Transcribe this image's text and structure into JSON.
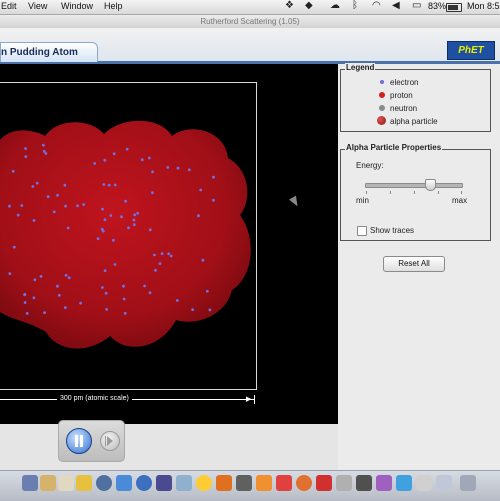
{
  "menubar": {
    "items": [
      "Edit",
      "View",
      "Window",
      "Help"
    ],
    "battery": "83%",
    "clock": "Mon 8:5",
    "icons": [
      "dropbox-icon",
      "evernote-icon",
      "bluetooth-icon",
      "wifi-icon",
      "volume-icon",
      "battery-icon"
    ]
  },
  "window": {
    "title": "Rutherford Scattering (1.05)"
  },
  "tab": {
    "label": "n Pudding Atom"
  },
  "logo": {
    "text": "PhET"
  },
  "scale_label": "300 pm (atomic scale)",
  "legend": {
    "title": "Legend",
    "items": [
      {
        "label": "electron",
        "color": "#6f6fd8"
      },
      {
        "label": "proton",
        "color": "#d02020"
      },
      {
        "label": "neutron",
        "color": "#8a8a8a"
      },
      {
        "label": "alpha particle",
        "color": "#c03030"
      }
    ]
  },
  "alpha_props": {
    "title": "Alpha Particle Properties",
    "energy_label": "Energy:",
    "min_label": "min",
    "max_label": "max",
    "energy_level": 0.67,
    "show_traces_label": "Show traces",
    "show_traces_checked": false
  },
  "reset_label": "Reset All",
  "colors": {
    "pudding": "#a10f17",
    "background": "#000000",
    "electron": "#7070e8",
    "tab_border": "#4a72a8"
  }
}
